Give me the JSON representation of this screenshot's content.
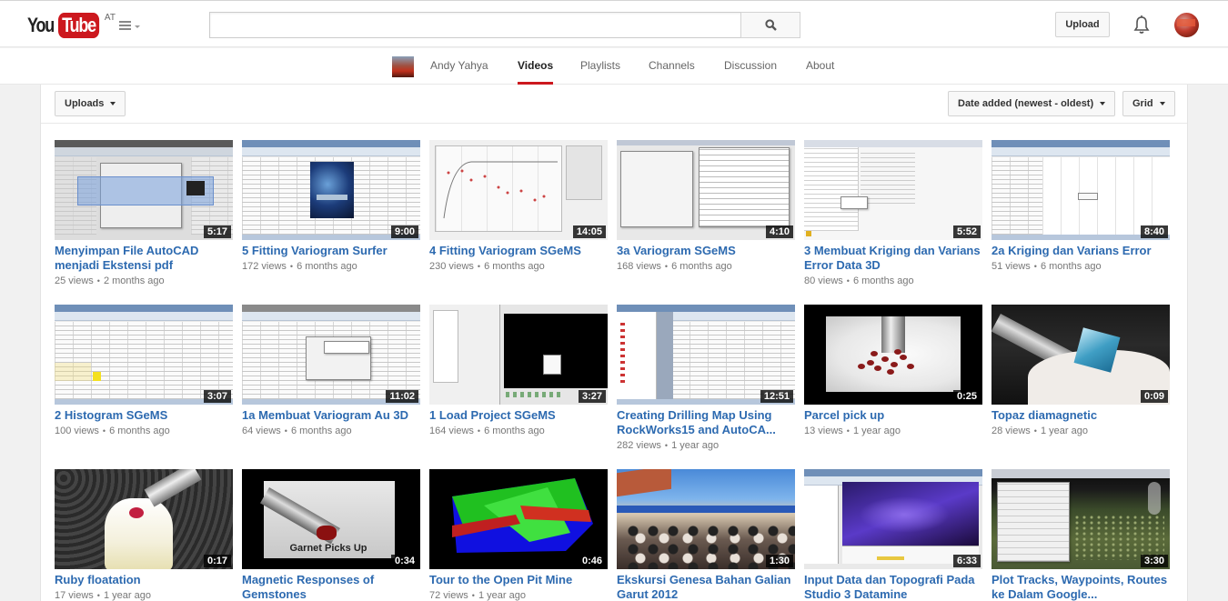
{
  "masthead": {
    "logo_you": "You",
    "logo_tube": "Tube",
    "region": "AT",
    "search_placeholder": "",
    "search_value": "",
    "upload_label": "Upload",
    "icons": {
      "guide": "hamburger-menu-icon",
      "search": "magnifier-icon",
      "notifications": "bell-icon",
      "account": "avatar"
    }
  },
  "channel": {
    "name": "Andy Yahya",
    "tabs": [
      "Videos",
      "Playlists",
      "Channels",
      "Discussion",
      "About"
    ],
    "active_tab": "Videos"
  },
  "toolbar": {
    "uploads_label": "Uploads",
    "sort_label": "Date added (newest - oldest)",
    "view_label": "Grid"
  },
  "colors": {
    "brand_red": "#cc181e",
    "link_blue": "#2d6ab0",
    "meta_gray": "#777777"
  },
  "videos": [
    {
      "title": "Menyimpan File AutoCAD menjadi Ekstensi pdf",
      "duration": "5:17",
      "views": "25 views",
      "age": "2 months ago"
    },
    {
      "title": "5 Fitting Variogram Surfer",
      "duration": "9:00",
      "views": "172 views",
      "age": "6 months ago"
    },
    {
      "title": "4 Fitting Variogram SGeMS",
      "duration": "14:05",
      "views": "230 views",
      "age": "6 months ago"
    },
    {
      "title": "3a Variogram SGeMS",
      "duration": "4:10",
      "views": "168 views",
      "age": "6 months ago"
    },
    {
      "title": "3 Membuat Kriging dan Varians Error Data 3D",
      "duration": "5:52",
      "views": "80 views",
      "age": "6 months ago"
    },
    {
      "title": "2a Kriging dan Varians Error",
      "duration": "8:40",
      "views": "51 views",
      "age": "6 months ago"
    },
    {
      "title": "2 Histogram SGeMS",
      "duration": "3:07",
      "views": "100 views",
      "age": "6 months ago"
    },
    {
      "title": "1a Membuat Variogram Au 3D",
      "duration": "11:02",
      "views": "64 views",
      "age": "6 months ago"
    },
    {
      "title": "1 Load Project SGeMS",
      "duration": "3:27",
      "views": "164 views",
      "age": "6 months ago"
    },
    {
      "title": "Creating Drilling Map Using RockWorks15 and AutoCA...",
      "duration": "12:51",
      "views": "282 views",
      "age": "1 year ago"
    },
    {
      "title": "Parcel pick up",
      "duration": "0:25",
      "views": "13 views",
      "age": "1 year ago"
    },
    {
      "title": "Topaz diamagnetic",
      "duration": "0:09",
      "views": "28 views",
      "age": "1 year ago"
    },
    {
      "title": "Ruby floatation",
      "duration": "0:17",
      "views": "17 views",
      "age": "1 year ago"
    },
    {
      "title": "Magnetic Responses of Gemstones",
      "duration": "0:34",
      "views": "",
      "age": "",
      "thumb_caption": "Garnet Picks Up"
    },
    {
      "title": "Tour to the Open Pit Mine",
      "duration": "0:46",
      "views": "72 views",
      "age": "1 year ago"
    },
    {
      "title": "Ekskursi Genesa Bahan Galian Garut 2012",
      "duration": "1:30",
      "views": "",
      "age": ""
    },
    {
      "title": "Input Data dan Topografi Pada Studio 3 Datamine",
      "duration": "6:33",
      "views": "",
      "age": ""
    },
    {
      "title": "Plot Tracks, Waypoints, Routes ke Dalam Google...",
      "duration": "3:30",
      "views": "",
      "age": ""
    }
  ],
  "meta_separator": "•"
}
